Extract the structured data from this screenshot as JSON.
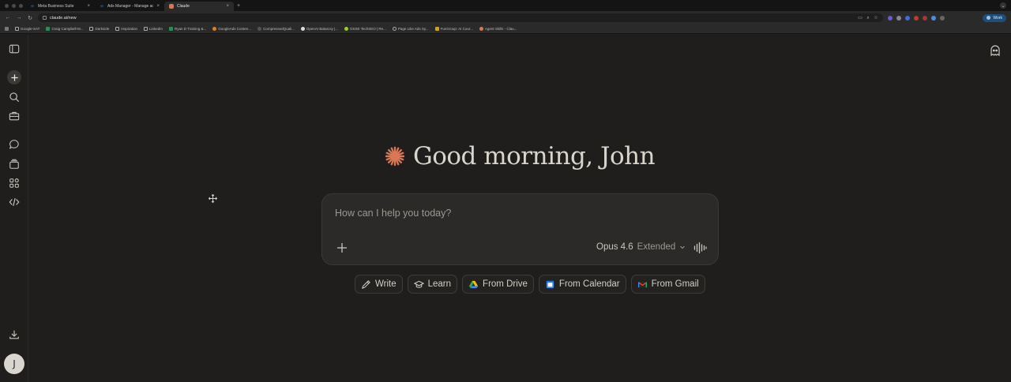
{
  "browser": {
    "tabs": [
      {
        "title": "Meta Business Suite",
        "favicon": "meta-icon",
        "active": false
      },
      {
        "title": "Ads Manager - Manage ads ...",
        "favicon": "meta-icon",
        "active": false
      },
      {
        "title": "Claude",
        "favicon": "claude-icon",
        "active": true
      }
    ],
    "new_tab": "+",
    "url": "claude.ai/new",
    "profile_label": "Work",
    "bookmarks": [
      "Google-SAT",
      "Craig Campbell-M...",
      "Darkside",
      "Inspiration",
      "LinkedIn",
      "Ryan D Training &...",
      "GoogleAds Conten...",
      "CompressedQuali...",
      "OpenAI Batarcsy |...",
      "OSSE TechSEO | Re...",
      "Page Like Ads Sy...",
      "FunGroup: AI Cour...",
      "Agent Skills - Clau..."
    ]
  },
  "sidebar": {
    "items": [
      {
        "name": "toggle-sidebar",
        "icon": "sidebar-icon"
      },
      {
        "name": "new-chat",
        "icon": "plus-icon"
      },
      {
        "name": "search",
        "icon": "search-icon"
      },
      {
        "name": "projects",
        "icon": "briefcase-icon"
      },
      {
        "name": "chats",
        "icon": "chat-icon"
      },
      {
        "name": "artifacts",
        "icon": "stack-icon"
      },
      {
        "name": "customize",
        "icon": "grid-icon"
      },
      {
        "name": "code",
        "icon": "code-icon"
      },
      {
        "name": "download",
        "icon": "download-icon"
      }
    ],
    "avatar_initial": "J"
  },
  "main": {
    "greeting": "Good morning, John",
    "composer": {
      "placeholder": "How can I help you today?",
      "model": "Opus 4.6",
      "mode": "Extended"
    },
    "chips": [
      {
        "label": "Write",
        "icon": "pencil-icon"
      },
      {
        "label": "Learn",
        "icon": "graduation-cap-icon"
      },
      {
        "label": "From Drive",
        "icon": "google-drive-icon"
      },
      {
        "label": "From Calendar",
        "icon": "google-calendar-icon"
      },
      {
        "label": "From Gmail",
        "icon": "gmail-icon"
      }
    ]
  },
  "colors": {
    "background": "#1f1e1d",
    "accent": "#d97757",
    "composer_bg": "#2b2a28"
  }
}
